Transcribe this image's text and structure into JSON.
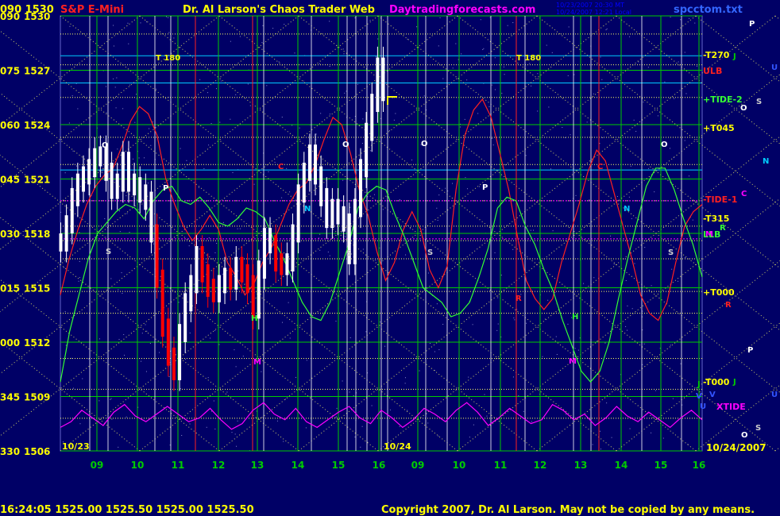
{
  "header": {
    "left_scale_top": "090",
    "price_top": "1530",
    "instrument": "S&P E-Mini",
    "site_title": "Dr. Al Larson's Chaos Trader Web",
    "site_url": "Daytradingforecasts.com",
    "file": "spcctom.txt",
    "stamp_1": "10/23/2007 20:30 MT",
    "stamp_2": "10/24/2007 12:21 Local"
  },
  "footer": {
    "quote": "16:24:05  1525.00 1525.50 1525.00 1525.50",
    "copyright": "Copyright 2007, Dr. Al Larson. May not be copied by any means."
  },
  "colors": {
    "background": "#000066",
    "price_bars": "#ffffff",
    "down_bars": "#ff0000",
    "grid_green": "#00cc00",
    "grid_yellow": "#ffff66",
    "red_curve": "#ff2020",
    "green_curve": "#33ff33",
    "xtide": "#ff00ff",
    "labels": "#ffff00"
  },
  "chart_data": {
    "type": "line",
    "title": "S&P E-Mini",
    "ylim": [
      1506,
      1530
    ],
    "yticks": [
      {
        "deg": "090",
        "price": "1530"
      },
      {
        "deg": "075",
        "price": "1527"
      },
      {
        "deg": "060",
        "price": "1524"
      },
      {
        "deg": "045",
        "price": "1521"
      },
      {
        "deg": "030",
        "price": "1518"
      },
      {
        "deg": "015",
        "price": "1515"
      },
      {
        "deg": "000",
        "price": "1512"
      },
      {
        "deg": "345",
        "price": "1509"
      },
      {
        "deg": "330",
        "price": "1506"
      }
    ],
    "x_hours": [
      "09",
      "10",
      "11",
      "12",
      "13",
      "14",
      "15",
      "16",
      "09",
      "10",
      "11",
      "12",
      "13",
      "14",
      "15",
      "16"
    ],
    "dates": {
      "start": "10/23",
      "mid": "10/24",
      "end": "10/24/2007"
    },
    "right_labels": [
      {
        "text": "-T270",
        "color": "#ffff00"
      },
      {
        "text": "ULB",
        "color": "#ff2020"
      },
      {
        "text": "+TIDE-2",
        "color": "#33ff33"
      },
      {
        "text": "+T045",
        "color": "#ffff00"
      },
      {
        "text": "-TIDE-1",
        "color": "#ff2020"
      },
      {
        "text": "-T315",
        "color": "#ffff00"
      },
      {
        "text": "LLB",
        "color": "#33ff33"
      },
      {
        "text": "+T000",
        "color": "#ffff00"
      },
      {
        "text": "-T000",
        "color": "#ffff00"
      },
      {
        "text": "XTIDE",
        "color": "#ff00ff"
      }
    ],
    "far_right": [
      {
        "text": "P",
        "color": "#ffffff"
      },
      {
        "text": "J",
        "color": "#00cc00"
      },
      {
        "text": "U",
        "color": "#3355ff"
      },
      {
        "text": "S",
        "color": "#cccccc"
      },
      {
        "text": "O",
        "color": "#ffffff"
      },
      {
        "text": "N",
        "color": "#00ccff"
      },
      {
        "text": "C",
        "color": "#ff00ff"
      },
      {
        "text": "R",
        "color": "#33ff33"
      },
      {
        "text": "M",
        "color": "#ff00ff"
      },
      {
        "text": "R",
        "color": "#ff2020"
      },
      {
        "text": "P",
        "color": "#ffffff"
      },
      {
        "text": "J",
        "color": "#00cc00"
      },
      {
        "text": "V",
        "color": "#3355ff"
      },
      {
        "text": "U",
        "color": "#3355ff"
      },
      {
        "text": "S",
        "color": "#cccccc"
      },
      {
        "text": "O",
        "color": "#ffffff"
      }
    ],
    "annotations": [
      {
        "text": "T 180",
        "color": "#ffff00"
      },
      {
        "text": "T 180",
        "color": "#ffff00"
      }
    ],
    "planet_marks": [
      {
        "text": "O",
        "color": "#ffffff"
      },
      {
        "text": "P",
        "color": "#ffffff"
      },
      {
        "text": "S",
        "color": "#cccccc"
      },
      {
        "text": "C",
        "color": "#ff2020"
      },
      {
        "text": "N",
        "color": "#00ccff"
      },
      {
        "text": "O",
        "color": "#ffffff"
      },
      {
        "text": "H",
        "color": "#33ff33"
      },
      {
        "text": "M",
        "color": "#ff00ff"
      },
      {
        "text": "S",
        "color": "#cccccc"
      },
      {
        "text": "O",
        "color": "#ffffff"
      },
      {
        "text": "S",
        "color": "#cccccc"
      },
      {
        "text": "P",
        "color": "#ffffff"
      },
      {
        "text": "R",
        "color": "#ff2020"
      },
      {
        "text": "H",
        "color": "#33ff33"
      },
      {
        "text": "M",
        "color": "#ff00ff"
      },
      {
        "text": "C",
        "color": "#ff2020"
      },
      {
        "text": "N",
        "color": "#00ccff"
      },
      {
        "text": "O",
        "color": "#ffffff"
      },
      {
        "text": "S",
        "color": "#cccccc"
      },
      {
        "text": "J",
        "color": "#00cc00"
      },
      {
        "text": "V",
        "color": "#3355ff"
      },
      {
        "text": "U",
        "color": "#3355ff"
      }
    ],
    "series": [
      {
        "values": [
          1517.5,
          1518.5,
          1520,
          1520.8,
          1521.2,
          1521.6,
          1522.2,
          1522.3,
          1521.4,
          1520.4,
          1520.8,
          1522,
          1520.8,
          1520.6,
          1520.2,
          1519.8,
          1518,
          1515.5,
          1512.8,
          1511.2,
          1510.4,
          1512.5,
          1514.2,
          1515.2,
          1516.8,
          1515.8,
          1515,
          1514.7,
          1515.2,
          1515.6,
          1515.4,
          1516.2,
          1515.8,
          1515.2,
          1513.8,
          1516,
          1517.8,
          1517.4,
          1516.4,
          1516.2,
          1516.4,
          1518,
          1520.2,
          1521.4,
          1522.4,
          1521.2,
          1520,
          1518.8,
          1519.4,
          1519,
          1518.6,
          1516.8,
          1519.4,
          1521.6,
          1523.6,
          1525.2,
          1527.2,
          1525.8
        ]
      },
      {
        "values": [
          1514.6,
          1516.6,
          1518.2,
          1519.6,
          1520.6,
          1521.2,
          1521.6,
          1522.8,
          1524.2,
          1525,
          1524.6,
          1523.4,
          1521,
          1519.6,
          1518.4,
          1517.6,
          1518.2,
          1519,
          1518.2,
          1516.4,
          1515.6,
          1514.6,
          1515.2,
          1516.4,
          1517.2,
          1518.4,
          1519.6,
          1520.4,
          1520.8,
          1521.8,
          1523.2,
          1524.4,
          1524,
          1522.4,
          1520.4,
          1519,
          1517,
          1515.4,
          1516.4,
          1518.2,
          1519.2,
          1518.2,
          1516,
          1515,
          1516.2,
          1520.4,
          1523.4,
          1524.8,
          1525.4,
          1524.4,
          1522.4,
          1520.4,
          1517.8,
          1515.4,
          1514.4,
          1513.8,
          1514.4,
          1516.4,
          1518,
          1519.6,
          1521.4,
          1522.6,
          1522,
          1520.2,
          1518.4,
          1516.6,
          1514.6,
          1513.6,
          1513.2,
          1514.2,
          1516.4,
          1518.4,
          1519.2,
          1519.6
        ]
      },
      {
        "values": [
          1509.8,
          1512.6,
          1514.6,
          1516.6,
          1518,
          1518.6,
          1519.2,
          1519.6,
          1519.4,
          1518.8,
          1519.8,
          1520.4,
          1520.6,
          1519.8,
          1519.6,
          1520,
          1519.4,
          1518.6,
          1518.4,
          1518.8,
          1519.4,
          1519.2,
          1518.8,
          1517.6,
          1516.6,
          1515.4,
          1514.2,
          1513.4,
          1513.2,
          1514.2,
          1515.8,
          1517.4,
          1519.4,
          1520.2,
          1520.6,
          1520.4,
          1519,
          1517.8,
          1516.4,
          1515,
          1514.6,
          1514.2,
          1513.4,
          1513.6,
          1514.2,
          1515.6,
          1517.2,
          1519.4,
          1520,
          1519.8,
          1518.4,
          1517.4,
          1516,
          1514.8,
          1513.2,
          1511.8,
          1510.4,
          1509.8,
          1510.4,
          1512,
          1514.4,
          1516.6,
          1518.6,
          1520.6,
          1521.6,
          1521.6,
          1520.4,
          1518.8,
          1517.4,
          1515.6
        ]
      },
      {
        "values": [
          330.8,
          331.4,
          332.6,
          331.8,
          331,
          332.4,
          333.2,
          332,
          331.4,
          332.2,
          333,
          332.2,
          331.4,
          331.8,
          332.8,
          331.6,
          330.6,
          331.2,
          332.6,
          333.4,
          332.2,
          331.6,
          332.8,
          331.4,
          330.8,
          331.6,
          332.4,
          333,
          331.8,
          331.2,
          332.6,
          331.8,
          330.8,
          331.6,
          332.8,
          332.2,
          331.4,
          332.6,
          333.4,
          332.4,
          331,
          331.8,
          332.8,
          332,
          331.2,
          331.6,
          333.2,
          332.6,
          331.6,
          332.2,
          331,
          331.8,
          333,
          332,
          331.4,
          332.4,
          331.6,
          330.8,
          331.8,
          332.6,
          331.6
        ]
      }
    ]
  }
}
